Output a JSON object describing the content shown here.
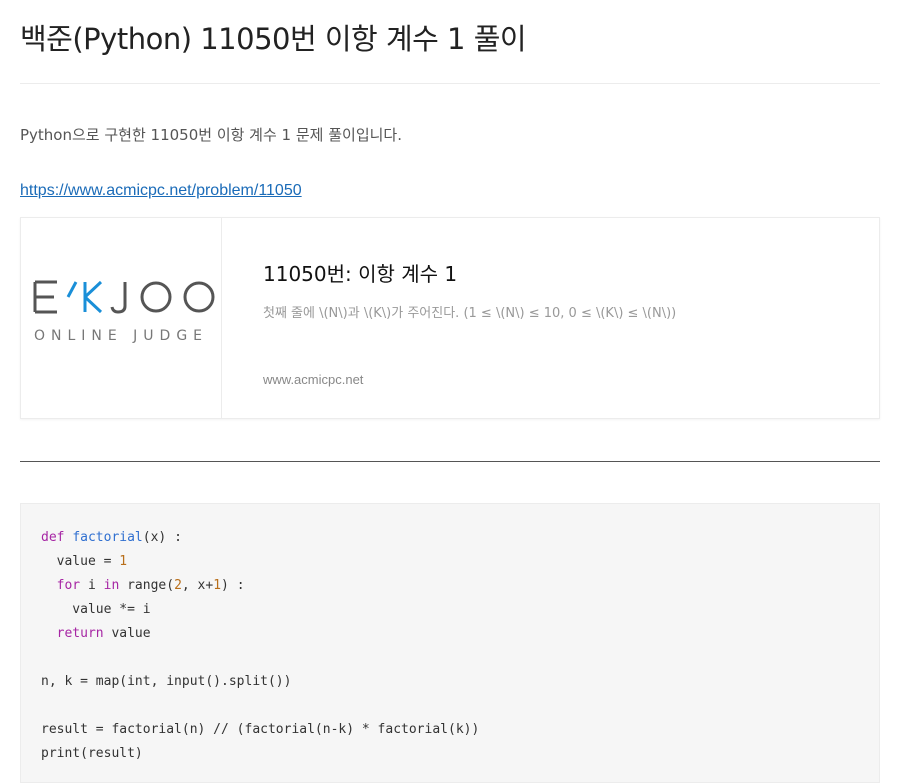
{
  "post": {
    "title": "백준(Python) 11050번 이항 계수 1 풀이",
    "intro": "Python으로 구현한 11050번 이항 계수 1 문제 풀이입니다.",
    "link": "https://www.acmicpc.net/problem/11050"
  },
  "og_card": {
    "logo_top": "E/KJOO",
    "logo_bottom": "ONLINE JUDGE",
    "logo_accent_color": "#1a8fd8",
    "title": "11050번: 이항 계수 1",
    "description": "첫째 줄에 \\(N\\)과 \\(K\\)가 주어진다. (1 ≤ \\(N\\) ≤ 10, 0 ≤ \\(K\\) ≤ \\(N\\))",
    "host": "www.acmicpc.net"
  },
  "code": {
    "l1_kw": "def",
    "l1_fn": "factorial",
    "l1_rest": "(x) :",
    "l2_a": "  value = ",
    "l2_num": "1",
    "l3_kw": "for",
    "l3_mid": " i ",
    "l3_kw2": "in",
    "l3_a": " range(",
    "l3_num": "2",
    "l3_b": ", x+",
    "l3_num2": "1",
    "l3_c": ") :",
    "l4": "    value *= i",
    "l5_kw": "return",
    "l5_rest": " value",
    "l7": "n, k = map(int, input().split())",
    "l9": "result = factorial(n) // (factorial(n-k) * factorial(k))",
    "l10": "print(result)"
  }
}
